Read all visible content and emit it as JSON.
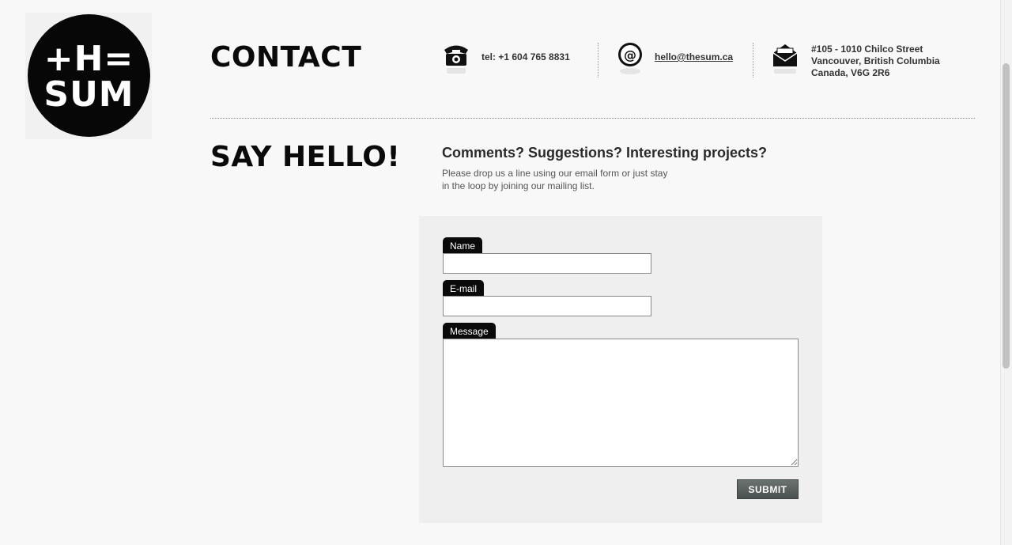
{
  "logo": {
    "line1": "+H=",
    "line2": "SUM"
  },
  "contact": {
    "heading": "CONTACT",
    "phone": "tel: +1 604 765 8831",
    "email": "hello@thesum.ca",
    "address": [
      "#105 - 1010 Chilco Street",
      "Vancouver, British Columbia",
      "Canada, V6G 2R6"
    ],
    "icons": {
      "phone": "telephone-icon",
      "email": "at-sign-icon",
      "address": "envelope-icon"
    }
  },
  "hello": {
    "heading": "SAY HELLO!",
    "subheading": "Comments? Suggestions? Interesting projects?",
    "intro_line1": "Please drop us a line using our email form or just stay",
    "intro_line2": "in the loop by joining our mailing list."
  },
  "form": {
    "name_label": "Name",
    "name_value": "",
    "email_label": "E-mail",
    "email_value": "",
    "message_label": "Message",
    "message_value": "",
    "submit_label": "SUBMIT"
  },
  "colors": {
    "background": "#f8f8f8",
    "panel": "#efefef",
    "label_bg": "#0a0a0a",
    "button": "#5a6160"
  }
}
